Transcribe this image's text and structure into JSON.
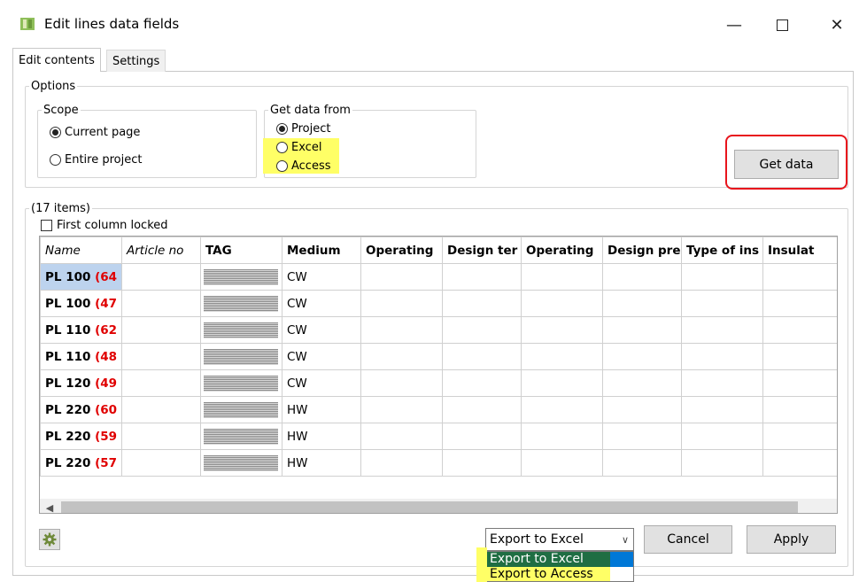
{
  "window": {
    "title": "Edit lines data fields"
  },
  "tabs": [
    "Edit contents",
    "Settings"
  ],
  "options": {
    "legend": "Options",
    "scope": {
      "legend": "Scope",
      "items": [
        "Current page",
        "Entire project"
      ],
      "selected": "Current page"
    },
    "source": {
      "legend": "Get data from",
      "items": [
        "Project",
        "Excel",
        "Access"
      ],
      "selected": "Project"
    },
    "get_data_label": "Get data"
  },
  "list": {
    "count_label": "(17 items)",
    "first_col_locked": "First column locked",
    "columns": [
      "Name",
      "Article no",
      "TAG",
      "Medium",
      "Operating",
      "Design ter",
      "Operating",
      "Design pre",
      "Type of ins",
      "Insulat"
    ],
    "rows": [
      {
        "name": "PL 100",
        "suffix": "(64",
        "medium": "CW"
      },
      {
        "name": "PL 100",
        "suffix": "(47",
        "medium": "CW"
      },
      {
        "name": "PL 110",
        "suffix": "(62",
        "medium": "CW"
      },
      {
        "name": "PL 110",
        "suffix": "(48",
        "medium": "CW"
      },
      {
        "name": "PL 120",
        "suffix": "(49",
        "medium": "CW"
      },
      {
        "name": "PL 220",
        "suffix": "(60",
        "medium": "HW"
      },
      {
        "name": "PL 220",
        "suffix": "(59",
        "medium": "HW"
      },
      {
        "name": "PL 220",
        "suffix": "(57",
        "medium": "HW"
      }
    ]
  },
  "bottom": {
    "export_selected": "Export to Excel",
    "export_options": [
      "Export to Excel",
      "Export to Access"
    ],
    "cancel_label": "Cancel",
    "apply_label": "Apply"
  },
  "colors": {
    "highlight": "#ffff66",
    "red_outline": "#e8141c",
    "selected_row": "#bdd3ee",
    "dropdown_selected": "#1f6e43"
  }
}
